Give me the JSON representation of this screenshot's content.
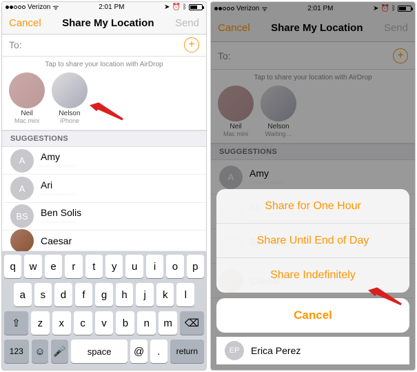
{
  "statusbar": {
    "carrier": "Verizon",
    "time": "2:01 PM",
    "wifi": "ᯤ",
    "loc": "➤",
    "alarm": "⏰",
    "bt": "ᛒ"
  },
  "nav": {
    "cancel": "Cancel",
    "title": "Share My Location",
    "send": "Send"
  },
  "to": {
    "label": "To:",
    "placeholder": ""
  },
  "airdrop": {
    "hint": "Tap to share your location with AirDrop",
    "people": [
      {
        "name": "Neil",
        "device": "Mac mini"
      },
      {
        "name": "Nelson",
        "device": "iPhone"
      }
    ],
    "people_right": [
      {
        "name": "Neil",
        "device": "Mac mini"
      },
      {
        "name": "Nelson",
        "device": "Waiting…"
      }
    ]
  },
  "suggestions_header": "SUGGESTIONS",
  "suggestions": [
    {
      "initial": "A",
      "name": "Amy",
      "sub": "············"
    },
    {
      "initial": "A",
      "name": "Ari",
      "sub": "············"
    },
    {
      "initial": "BS",
      "name": "Ben Solis",
      "sub": "············"
    },
    {
      "initial": "",
      "name": "Caesar",
      "sub": "",
      "img": true
    }
  ],
  "suggestions_right_extra": {
    "initial": "EP",
    "name": "Erica Perez",
    "sub": ""
  },
  "keyboard": {
    "r1": [
      "q",
      "w",
      "e",
      "r",
      "t",
      "y",
      "u",
      "i",
      "o",
      "p"
    ],
    "r2": [
      "a",
      "s",
      "d",
      "f",
      "g",
      "h",
      "j",
      "k",
      "l"
    ],
    "r3": [
      "z",
      "x",
      "c",
      "v",
      "b",
      "n",
      "m"
    ],
    "num": "123",
    "emoji": "☺",
    "mic": "🎤",
    "space": "space",
    "at": "@",
    "dot": ".",
    "return": "return",
    "shift": "⇧",
    "del": "⌫"
  },
  "sheet": {
    "opt1": "Share for One Hour",
    "opt2": "Share Until End of Day",
    "opt3": "Share Indefinitely",
    "cancel": "Cancel"
  }
}
